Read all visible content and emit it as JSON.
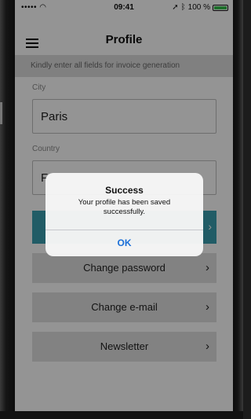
{
  "status_bar": {
    "signal": "••••• ",
    "time": "09:41",
    "battery": "100 %"
  },
  "nav": {
    "title": "Profile"
  },
  "notice": "Kindly enter all fields for invoice generation",
  "form": {
    "city_label": "City",
    "city_value": "Paris",
    "country_label": "Country",
    "country_value": "F"
  },
  "buttons": {
    "change_password": "Change password",
    "change_email": "Change e-mail",
    "newsletter": "Newsletter"
  },
  "alert": {
    "title": "Success",
    "message": "Your profile has been saved successfully.",
    "ok": "OK"
  },
  "colors": {
    "accent": "#3a9fb0",
    "link": "#1a6fd8"
  }
}
